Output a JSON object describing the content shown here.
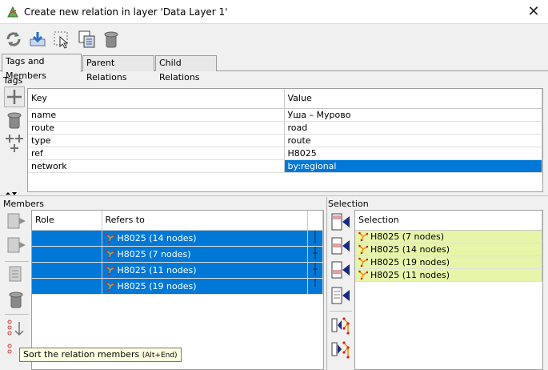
{
  "window": {
    "title": "Create new relation in layer 'Data Layer 1'",
    "close_glyph": "✕"
  },
  "toolbar": {
    "buttons": [
      "refresh-icon",
      "download-icon",
      "select-icon",
      "duplicate-icon",
      "delete-icon"
    ]
  },
  "tabs": [
    {
      "label": "Tags and Members",
      "active": true
    },
    {
      "label": "Parent Relations",
      "active": false
    },
    {
      "label": "Child Relations",
      "active": false
    }
  ],
  "tags": {
    "section_label": "Tags",
    "columns": [
      "Key",
      "Value"
    ],
    "rows": [
      {
        "key": "name",
        "value": "Уша – Мурово"
      },
      {
        "key": "route",
        "value": "road"
      },
      {
        "key": "type",
        "value": "route"
      },
      {
        "key": "ref",
        "value": "H8025"
      },
      {
        "key": "network",
        "value": "by:regional"
      }
    ],
    "selected_index": 4
  },
  "members": {
    "section_label": "Members",
    "columns": [
      "Role",
      "Refers to"
    ],
    "rows": [
      {
        "role": "",
        "refers_to": "H8025 (14 nodes)"
      },
      {
        "role": "",
        "refers_to": "H8025 (7 nodes)"
      },
      {
        "role": "",
        "refers_to": "H8025 (11 nodes)"
      },
      {
        "role": "",
        "refers_to": "H8025 (19 nodes)"
      }
    ]
  },
  "selection": {
    "section_label": "Selection",
    "column": "Selection",
    "rows": [
      "H8025 (7 nodes)",
      "H8025 (14 nodes)",
      "H8025 (19 nodes)",
      "H8025 (11 nodes)"
    ]
  },
  "tooltip": {
    "text": "Sort the relation members",
    "shortcut": "(Alt+End)"
  },
  "colors": {
    "selection_blue": "#0078d7",
    "lime": "#e6f5a8",
    "arrow_navy": "#1a2a80"
  }
}
